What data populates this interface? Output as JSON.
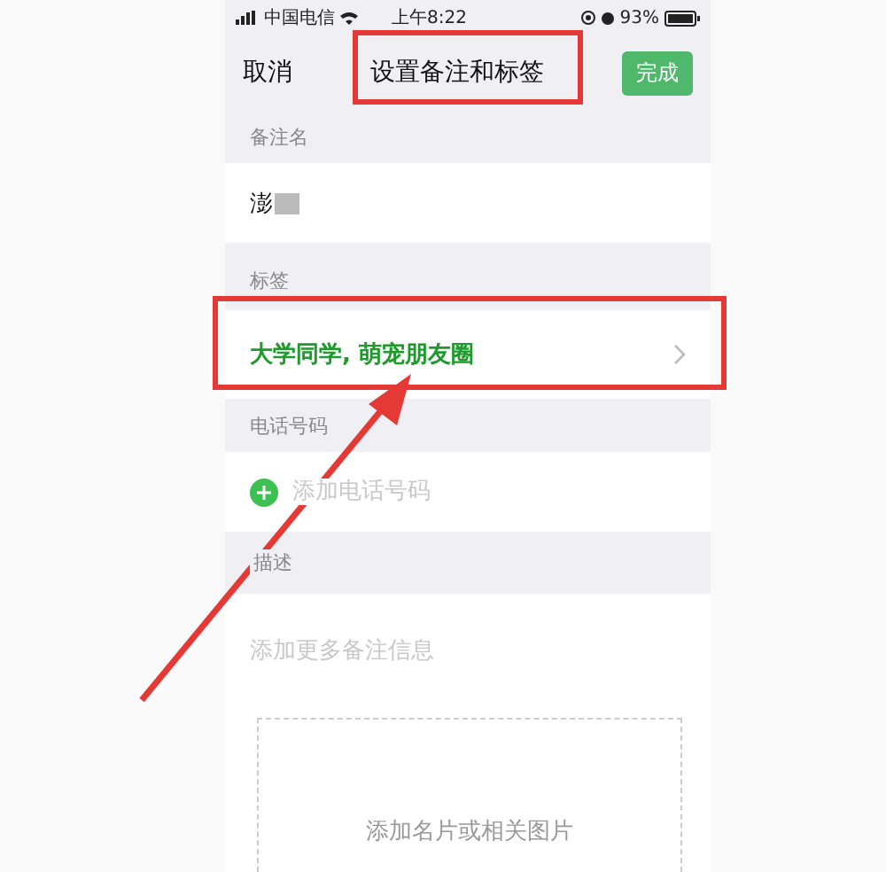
{
  "status_bar": {
    "carrier": "中国电信",
    "time": "上午8:22",
    "battery": "93%"
  },
  "nav": {
    "cancel": "取消",
    "title": "设置备注和标签",
    "done": {
      "label": "完成",
      "disabled": true
    }
  },
  "remark": {
    "label": "备注名",
    "value": "澎",
    "redacted": true
  },
  "tags": {
    "label": "标签",
    "value": "大学同学, 萌宠朋友圈"
  },
  "phone": {
    "label": "电话号码",
    "placeholder": "添加电话号码"
  },
  "description": {
    "label": "描述",
    "placeholder": "添加更多备注信息",
    "image_hint": "添加名片或相关图片"
  }
}
